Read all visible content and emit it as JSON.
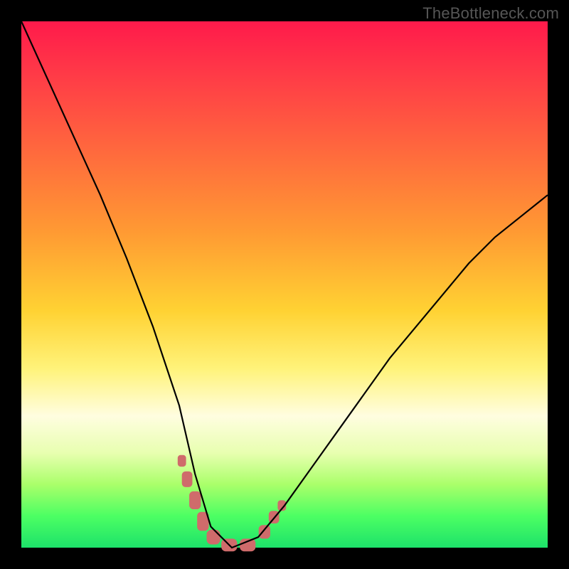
{
  "watermark": "TheBottleneck.com",
  "chart_data": {
    "type": "line",
    "title": "",
    "xlabel": "",
    "ylabel": "",
    "xlim": [
      0,
      100
    ],
    "ylim": [
      0,
      100
    ],
    "series": [
      {
        "name": "bottleneck-curve",
        "x": [
          0,
          5,
          10,
          15,
          20,
          25,
          30,
          33,
          36,
          40,
          45,
          50,
          55,
          60,
          65,
          70,
          75,
          80,
          85,
          90,
          95,
          100
        ],
        "values": [
          100,
          89,
          78,
          67,
          55,
          42,
          27,
          14,
          4,
          0,
          2,
          8,
          15,
          22,
          29,
          36,
          42,
          48,
          54,
          59,
          63,
          67
        ]
      }
    ],
    "annotations": [
      {
        "name": "marker-cluster",
        "type": "rect-markers",
        "color": "#cf6b6b",
        "points": [
          {
            "x": 30.5,
            "y": 16.5,
            "w": 1.6,
            "h": 2.2
          },
          {
            "x": 31.5,
            "y": 13.0,
            "w": 2.0,
            "h": 3.0
          },
          {
            "x": 33.0,
            "y": 9.0,
            "w": 2.2,
            "h": 3.4
          },
          {
            "x": 34.5,
            "y": 5.0,
            "w": 2.2,
            "h": 3.6
          },
          {
            "x": 36.5,
            "y": 2.0,
            "w": 2.6,
            "h": 2.8
          },
          {
            "x": 39.5,
            "y": 0.5,
            "w": 3.0,
            "h": 2.4
          },
          {
            "x": 43.0,
            "y": 0.5,
            "w": 3.0,
            "h": 2.4
          },
          {
            "x": 46.2,
            "y": 3.0,
            "w": 2.2,
            "h": 2.6
          },
          {
            "x": 48.0,
            "y": 5.8,
            "w": 2.0,
            "h": 2.4
          },
          {
            "x": 49.5,
            "y": 8.0,
            "w": 1.6,
            "h": 2.0
          }
        ]
      }
    ]
  }
}
